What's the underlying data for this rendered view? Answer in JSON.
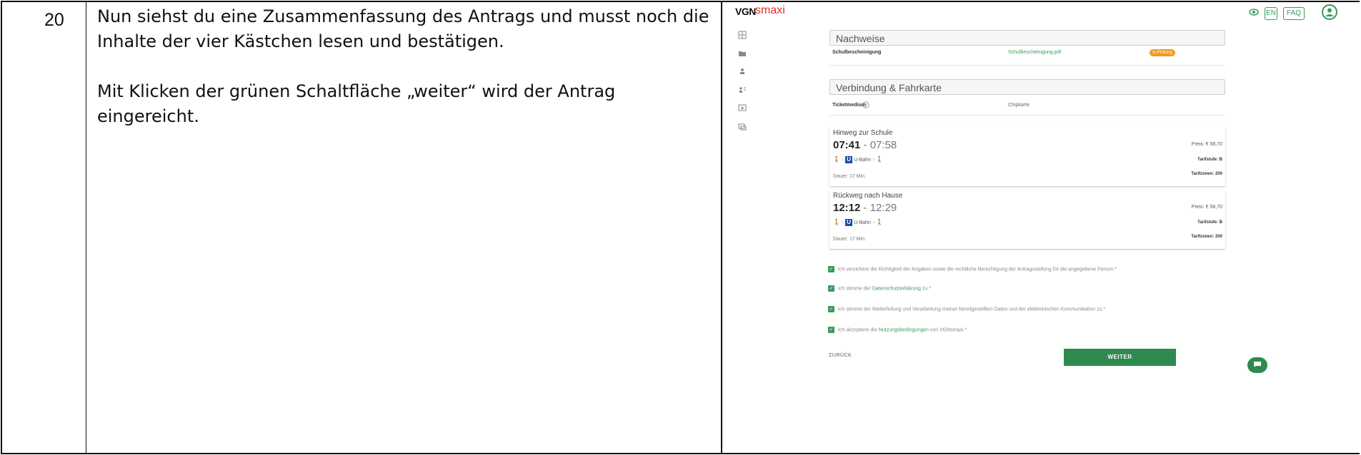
{
  "doc": {
    "step_number": "20",
    "instruction_lines": [
      "Nun siehst du eine Zusammenfassung des Antrags und musst noch die",
      "Inhalte der vier Kästchen lesen und bestätigen.",
      "Mit Klicken der grünen Schaltfläche „weiter“ wird der Antrag",
      "eingereicht."
    ]
  },
  "app": {
    "logo_vgn": "VGN",
    "logo_smaxi": "smaxi",
    "lang_button": "EN",
    "faq_button": "FAQ",
    "sidebar_icons": [
      "grid-icon",
      "folder-icon",
      "person-icon",
      "people-icon",
      "download-icon",
      "chat-icon"
    ],
    "nachweise": {
      "title": "Nachweise",
      "row_label": "Schulbescheinigung",
      "file_link": "Schulbescheinigung.pdf",
      "status_badge": "In Prüfung"
    },
    "verbindung": {
      "title": "Verbindung & Fahrkarte",
      "row_label": "Ticketmedium",
      "row_value": "Chipkarte"
    },
    "routes": [
      {
        "title": "Hinweg zur Schule",
        "dep": "07:41",
        "sep": " - ",
        "arr": "07:58",
        "mode": "U-Bahn",
        "price": "Preis: € 58,70",
        "tarif": "Tarifstufe: B",
        "zones": "Tarifzonen: 200",
        "duration": "Dauer: 17 Min."
      },
      {
        "title": "Rückweg nach Hause",
        "dep": "12:12",
        "sep": " - ",
        "arr": "12:29",
        "mode": "U-Bahn",
        "price": "Preis: € 58,70",
        "tarif": "Tarifstufe: B",
        "zones": "Tarifzonen: 200",
        "duration": "Dauer: 17 Min."
      }
    ],
    "consents": [
      {
        "text": "Ich versichere die Richtigkeit der Angaben sowie die rechtliche Berechtigung der Antragsstellung für die angegebene Person.*"
      },
      {
        "pre": "Ich stimme der ",
        "link": "Datenschutzerklärung",
        "post": " zu.*"
      },
      {
        "text": "Ich stimme der Weiterleitung und Verarbeitung meiner bereitgestellten Daten und der elektronischen Kommunikation zu.*"
      },
      {
        "pre": "Ich akzeptiere die ",
        "link": "Nutzungsbedingungen",
        "post": " von VGNsmaxi.*"
      }
    ],
    "back_button": "ZURÜCK",
    "next_button": "WEITER",
    "colors": {
      "green": "#2f8a4f",
      "badge": "#f09a1e",
      "ubahn": "#1b4aa8",
      "logo_red": "#e2332a"
    }
  }
}
